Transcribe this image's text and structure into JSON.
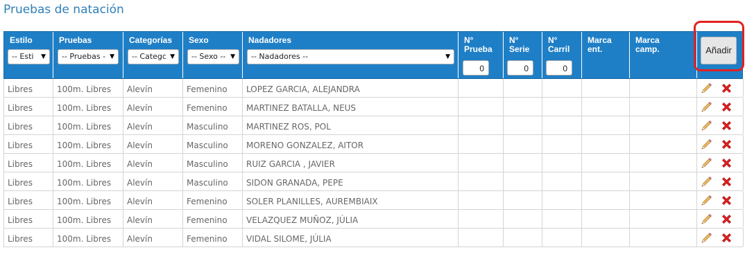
{
  "page": {
    "title": "Pruebas de natación"
  },
  "header": {
    "estilo": {
      "label": "Estilo",
      "filter": "-- Esti"
    },
    "pruebas": {
      "label": "Pruebas",
      "filter": "-- Pruebas -"
    },
    "categorias": {
      "label": "Categorías",
      "filter": "-- Categc"
    },
    "sexo": {
      "label": "Sexo",
      "filter": "-- Sexo --"
    },
    "nadadores": {
      "label": "Nadadores",
      "filter": "-- Nadadores --"
    },
    "n_prueba": {
      "label_1": "N°",
      "label_2": "Prueba",
      "value": "0"
    },
    "n_serie": {
      "label_1": "N°",
      "label_2": "Serie",
      "value": "0"
    },
    "n_carril": {
      "label_1": "N°",
      "label_2": "Carril",
      "value": "0"
    },
    "marca_ent": {
      "label_1": "Marca",
      "label_2": "ent."
    },
    "marca_camp": {
      "label_1": "Marca",
      "label_2": "camp."
    },
    "add_label": "Añadir"
  },
  "rows": [
    {
      "estilo": "Libres",
      "prueba": "100m. Libres",
      "categoria": "Alevín",
      "sexo": "Femenino",
      "nadador": "LOPEZ GARCIA, ALEJANDRA"
    },
    {
      "estilo": "Libres",
      "prueba": "100m. Libres",
      "categoria": "Alevín",
      "sexo": "Femenino",
      "nadador": "MARTINEZ BATALLA, NEUS"
    },
    {
      "estilo": "Libres",
      "prueba": "100m. Libres",
      "categoria": "Alevín",
      "sexo": "Masculino",
      "nadador": "MARTINEZ ROS, POL"
    },
    {
      "estilo": "Libres",
      "prueba": "100m. Libres",
      "categoria": "Alevín",
      "sexo": "Masculino",
      "nadador": "MORENO GONZALEZ, AITOR"
    },
    {
      "estilo": "Libres",
      "prueba": "100m. Libres",
      "categoria": "Alevín",
      "sexo": "Masculino",
      "nadador": "RUIZ GARCIA , JAVIER"
    },
    {
      "estilo": "Libres",
      "prueba": "100m. Libres",
      "categoria": "Alevín",
      "sexo": "Masculino",
      "nadador": "SIDON GRANADA, PEPE"
    },
    {
      "estilo": "Libres",
      "prueba": "100m. Libres",
      "categoria": "Alevín",
      "sexo": "Femenino",
      "nadador": "SOLER PLANILLES, AUREMBIAIX"
    },
    {
      "estilo": "Libres",
      "prueba": "100m. Libres",
      "categoria": "Alevín",
      "sexo": "Femenino",
      "nadador": "VELAZQUEZ MUÑOZ, JÚLIA"
    },
    {
      "estilo": "Libres",
      "prueba": "100m. Libres",
      "categoria": "Alevín",
      "sexo": "Femenino",
      "nadador": "VIDAL SILOME, JÚLIA"
    }
  ],
  "icons": {
    "edit": "pencil-icon",
    "delete": "red-x-icon"
  },
  "colors": {
    "header_bg": "#1f7fc6",
    "title": "#2f7fb8",
    "highlight_ring": "#e22121",
    "delete": "#e02020"
  }
}
